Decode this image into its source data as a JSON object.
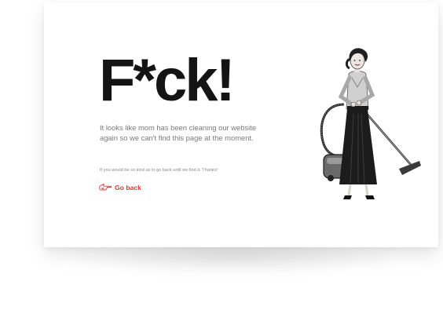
{
  "page": {
    "headline": "F*ck!",
    "message": "It looks like mom has been cleaning our website again so we can't find this page at the moment.",
    "small_note": "If you would be so kind as to go back until we find it. Thanks!",
    "go_back_label": "Go back",
    "go_back_icon": "pointing-hand-icon",
    "illustration": "woman-vacuum-illustration"
  },
  "colors": {
    "background": "#ffffff",
    "headline": "#141414",
    "body_text": "#7a7a7a",
    "accent": "#d83a3a"
  }
}
